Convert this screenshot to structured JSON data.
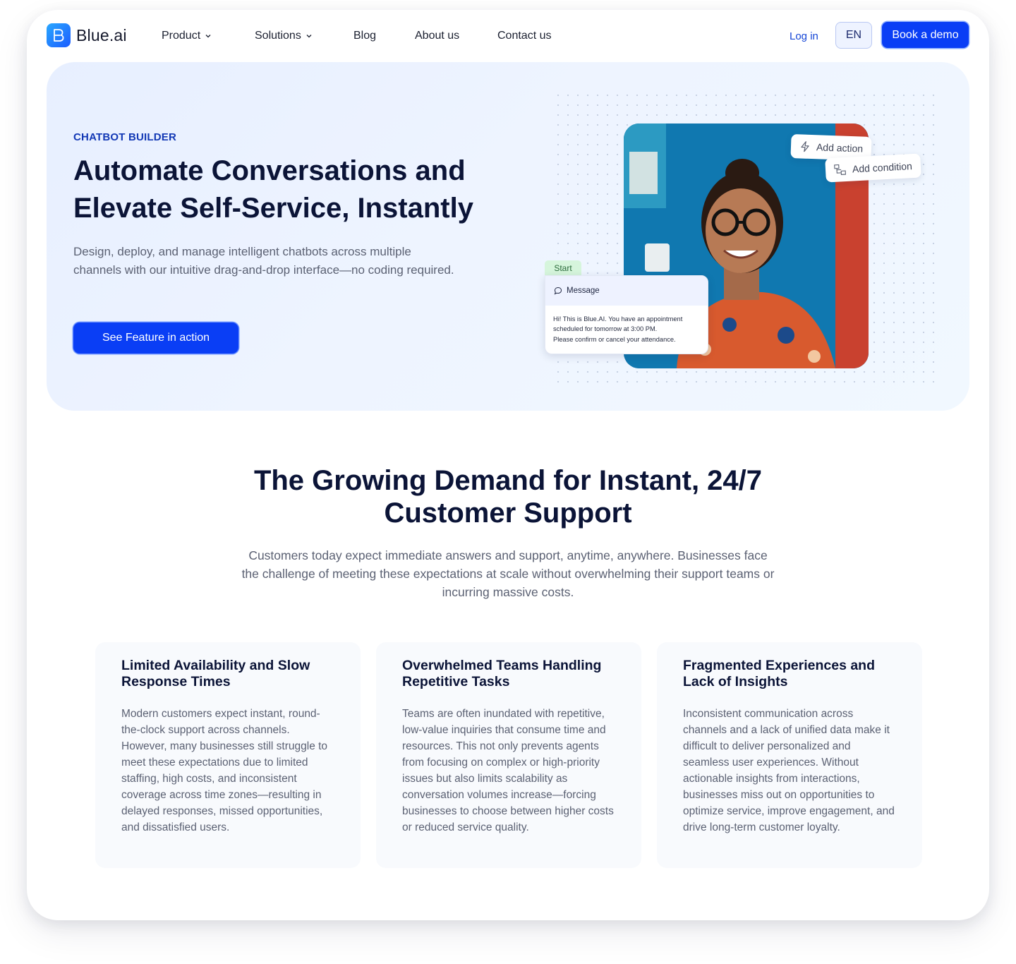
{
  "brand": {
    "name": "Blue.ai",
    "accent": "#0a3ef5",
    "dark": "#0b1437"
  },
  "nav": {
    "items": [
      {
        "label": "Product",
        "dropdown": true
      },
      {
        "label": "Solutions",
        "dropdown": true
      },
      {
        "label": "Blog",
        "dropdown": false
      },
      {
        "label": "About us",
        "dropdown": false
      },
      {
        "label": "Contact us",
        "dropdown": false
      }
    ],
    "login": "Log in",
    "language": "EN",
    "demo": "Book a demo"
  },
  "hero": {
    "eyebrow": "CHATBOT BUILDER",
    "title_line1": "Automate Conversations and",
    "title_line2": "Elevate Self-Service, Instantly",
    "subtitle": "Design, deploy, and manage intelligent chatbots across multiple channels with our intuitive drag-and-drop interface—no coding required.",
    "cta": "See Feature in action",
    "builder": {
      "add_action": "Add action",
      "add_condition": "Add condition",
      "start_tag": "Start",
      "message_title": "Message",
      "message_line1": "Hi! This is Blue.AI. You have an appointment",
      "message_line2": "scheduled for tomorrow at 3:00 PM.",
      "message_line3": "Please confirm or cancel your attendance."
    }
  },
  "demand": {
    "title_line1": "The Growing Demand for Instant, 24/7",
    "title_line2": "Customer Support",
    "subtitle": "Customers today expect immediate answers and support, anytime, anywhere. Businesses face the challenge of meeting these expectations at scale without overwhelming their support teams or incurring massive costs.",
    "cards": [
      {
        "title": "Limited Availability and Slow Response Times",
        "body": "Modern customers expect instant, round-the-clock support across channels. However, many businesses still struggle to meet these expectations due to limited staffing, high costs, and inconsistent coverage across time zones—resulting in delayed responses, missed opportunities, and dissatisfied users."
      },
      {
        "title": "Overwhelmed Teams Handling Repetitive Tasks",
        "body": "Teams are often inundated with repetitive, low-value inquiries that consume time and resources. This not only prevents agents from focusing on complex or high-priority issues but also limits scalability as conversation volumes increase—forcing businesses to choose between higher costs or reduced service quality."
      },
      {
        "title": "Fragmented Experiences and Lack of Insights",
        "body": "Inconsistent communication across channels and a lack of unified data make it difficult to deliver personalized and seamless user experiences. Without actionable insights from interactions, businesses miss out on opportunities to optimize service, improve engagement, and drive long-term customer loyalty."
      }
    ]
  }
}
